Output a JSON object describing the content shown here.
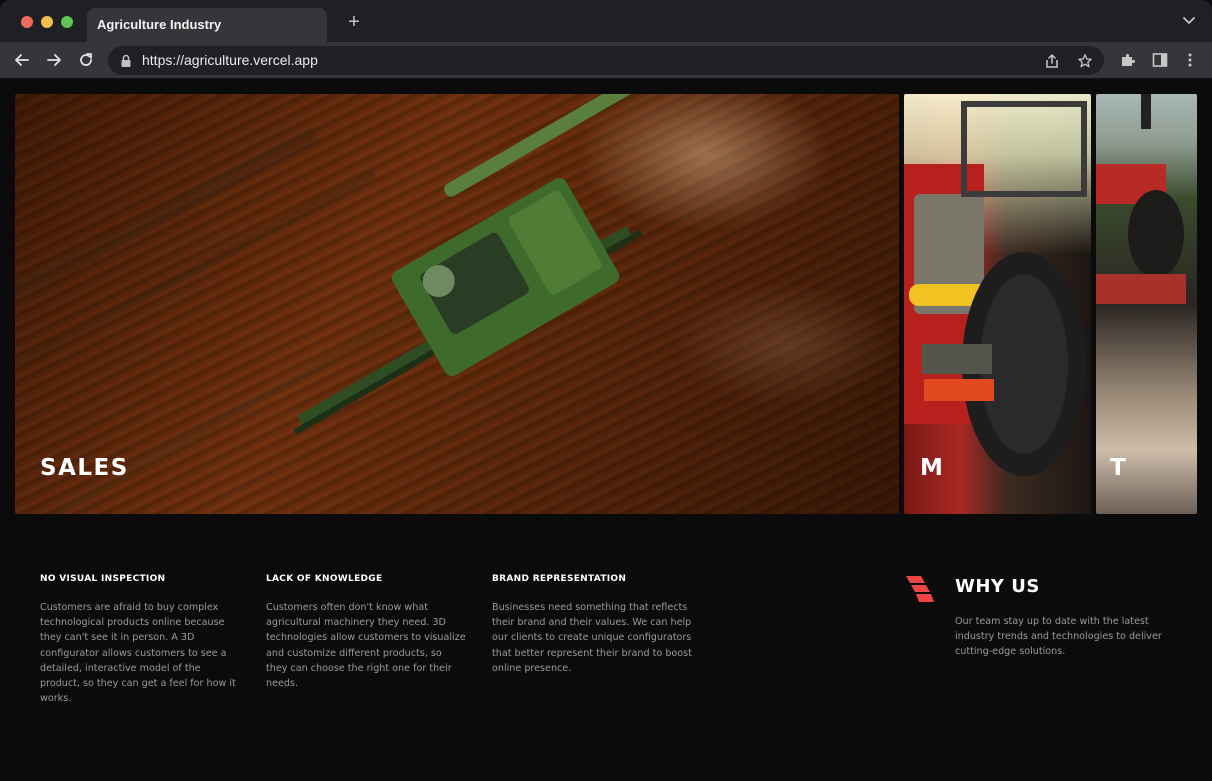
{
  "browser": {
    "tab_title": "Agriculture Industry",
    "new_tab_label": "+",
    "url": "https://agriculture.vercel.app"
  },
  "icons": {
    "back": "arrow-left-icon",
    "forward": "arrow-right-icon",
    "reload": "reload-icon",
    "lock": "lock-icon",
    "share": "share-icon",
    "bookmark": "star-icon",
    "extensions": "puzzle-icon",
    "sidepanel": "sidepanel-icon",
    "menu": "kebab-menu-icon"
  },
  "panels": [
    {
      "label": "SALES"
    },
    {
      "label": "M"
    },
    {
      "label": "T"
    }
  ],
  "columns": [
    {
      "heading": "NO VISUAL INSPECTION",
      "text": "Customers are afraid to buy complex technological products online because they can't see it in person. A 3D configurator allows customers to see a detailed, interactive model of the product, so they can get a feel for how it works."
    },
    {
      "heading": "LACK OF KNOWLEDGE",
      "text": "Customers often don't know what agricultural machinery they need. 3D technologies allow customers to visualize and customize different products, so they can choose the right one for their needs."
    },
    {
      "heading": "BRAND REPRESENTATION",
      "text": "Businesses need something that reflects their brand and their values. We can help our clients to create unique configurators that better represent their brand to boost online presence."
    }
  ],
  "why_us": {
    "title": "WHY US",
    "text": "Our team stay up to date with the latest industry trends and technologies to deliver cutting-edge solutions."
  },
  "colors": {
    "accent": "#ef4444",
    "background": "#0b0b0c"
  }
}
